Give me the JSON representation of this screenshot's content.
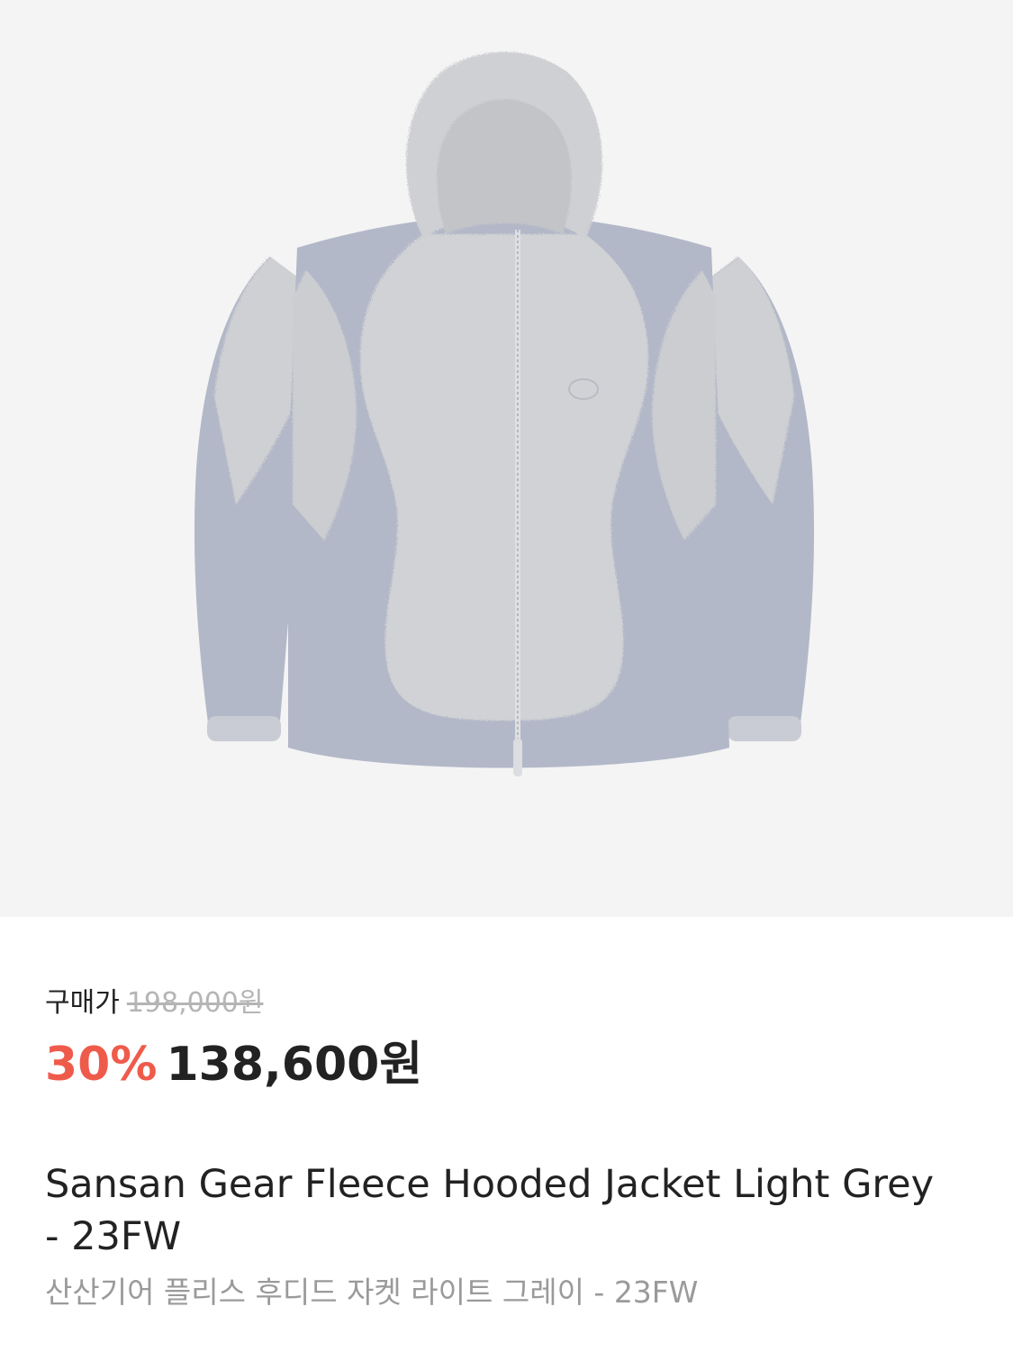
{
  "product": {
    "image_icon": "fleece-hooded-jacket-photo",
    "price_label": "구매가",
    "original_price": "198,000원",
    "discount_rate": "30%",
    "sale_price": "138,600원",
    "name_en": "Sansan Gear Fleece Hooded Jacket Light Grey - 23FW",
    "name_ko": "산산기어 플리스 후디드 자켓 라이트 그레이 - 23FW"
  },
  "colors": {
    "image_background": "#f4f4f4",
    "discount": "#ef5b4b",
    "primary_text": "#222222",
    "strikethrough_text": "#b5b5b5",
    "secondary_text": "#9a9a9a",
    "fleece": "#cfd0d3",
    "nylon_panel": "#b3b8c8"
  }
}
